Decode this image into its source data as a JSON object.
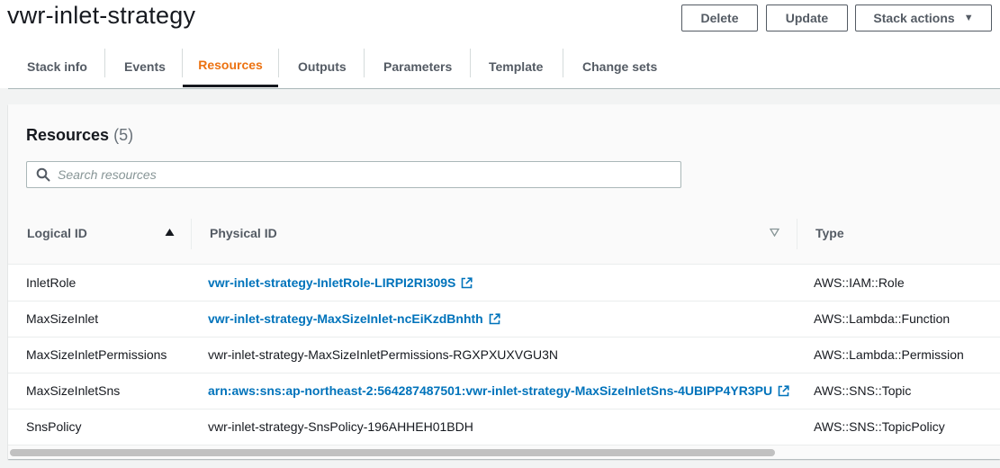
{
  "header": {
    "title": "vwr-inlet-strategy",
    "delete_label": "Delete",
    "update_label": "Update",
    "stack_actions_label": "Stack actions"
  },
  "tabs": [
    {
      "label": "Stack info",
      "active": false
    },
    {
      "label": "Events",
      "active": false
    },
    {
      "label": "Resources",
      "active": true
    },
    {
      "label": "Outputs",
      "active": false
    },
    {
      "label": "Parameters",
      "active": false
    },
    {
      "label": "Template",
      "active": false
    },
    {
      "label": "Change sets",
      "active": false
    }
  ],
  "resources": {
    "title": "Resources",
    "count": "(5)",
    "search_placeholder": "Search resources",
    "search_value": "",
    "columns": {
      "logical_id": "Logical ID",
      "physical_id": "Physical ID",
      "type": "Type"
    },
    "rows": [
      {
        "logical_id": "InletRole",
        "physical_id": "vwr-inlet-strategy-InletRole-LIRPI2RI309S",
        "is_link": true,
        "type": "AWS::IAM::Role"
      },
      {
        "logical_id": "MaxSizeInlet",
        "physical_id": "vwr-inlet-strategy-MaxSizeInlet-ncEiKzdBnhth",
        "is_link": true,
        "type": "AWS::Lambda::Function"
      },
      {
        "logical_id": "MaxSizeInletPermissions",
        "physical_id": "vwr-inlet-strategy-MaxSizeInletPermissions-RGXPXUXVGU3N",
        "is_link": false,
        "type": "AWS::Lambda::Permission"
      },
      {
        "logical_id": "MaxSizeInletSns",
        "physical_id": "arn:aws:sns:ap-northeast-2:564287487501:vwr-inlet-strategy-MaxSizeInletSns-4UBIPP4YR3PU",
        "is_link": true,
        "type": "AWS::SNS::Topic"
      },
      {
        "logical_id": "SnsPolicy",
        "physical_id": "vwr-inlet-strategy-SnsPolicy-196AHHEH01BDH",
        "is_link": false,
        "type": "AWS::SNS::TopicPolicy"
      }
    ]
  },
  "colors": {
    "accent_tab": "#ec7211",
    "link": "#0073bb",
    "text": "#16191f",
    "muted": "#545b64"
  },
  "icons": {
    "search": "search-icon",
    "external_link": "external-link-icon",
    "sort_asc": "sort-ascending-icon",
    "sort_desc": "sort-descending-icon",
    "dropdown": "caret-down-icon"
  }
}
